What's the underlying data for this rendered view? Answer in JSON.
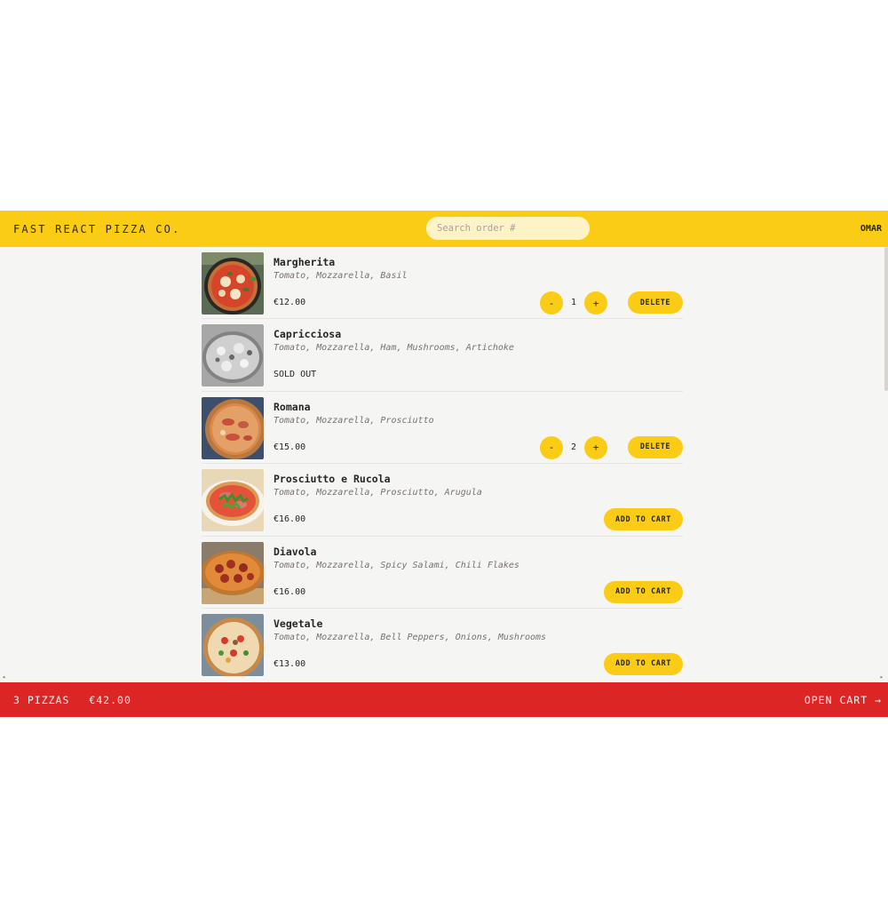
{
  "header": {
    "logo": "Fast React Pizza Co.",
    "search_placeholder": "Search order #",
    "username": "OMAR"
  },
  "menu": {
    "items": [
      {
        "name": "Margherita",
        "ingredients": "Tomato, Mozzarella, Basil",
        "price": "€12.00",
        "sold_out": false,
        "in_cart": true,
        "quantity": "1",
        "decrease_label": "-",
        "increase_label": "+",
        "action_label": "DELETE"
      },
      {
        "name": "Capricciosa",
        "ingredients": "Tomato, Mozzarella, Ham, Mushrooms, Artichoke",
        "sold_out": true,
        "sold_out_label": "SOLD OUT"
      },
      {
        "name": "Romana",
        "ingredients": "Tomato, Mozzarella, Prosciutto",
        "price": "€15.00",
        "sold_out": false,
        "in_cart": true,
        "quantity": "2",
        "decrease_label": "-",
        "increase_label": "+",
        "action_label": "DELETE"
      },
      {
        "name": "Prosciutto e Rucola",
        "ingredients": "Tomato, Mozzarella, Prosciutto, Arugula",
        "price": "€16.00",
        "sold_out": false,
        "in_cart": false,
        "action_label": "ADD TO CART"
      },
      {
        "name": "Diavola",
        "ingredients": "Tomato, Mozzarella, Spicy Salami, Chili Flakes",
        "price": "€16.00",
        "sold_out": false,
        "in_cart": false,
        "action_label": "ADD TO CART"
      },
      {
        "name": "Vegetale",
        "ingredients": "Tomato, Mozzarella, Bell Peppers, Onions, Mushrooms",
        "price": "€13.00",
        "sold_out": false,
        "in_cart": false,
        "action_label": "ADD TO CART"
      }
    ]
  },
  "cart": {
    "count": "3 PIZZAS",
    "total": "€42.00",
    "open_label": "OPEN CART →"
  },
  "scrollbar": {
    "left_arrow": "◂",
    "right_arrow": "▸"
  },
  "colors": {
    "header_bg": "#facc15",
    "cart_bg": "#dc2626",
    "page_bg": "#f5f5f4",
    "button_bg": "#facc15"
  }
}
